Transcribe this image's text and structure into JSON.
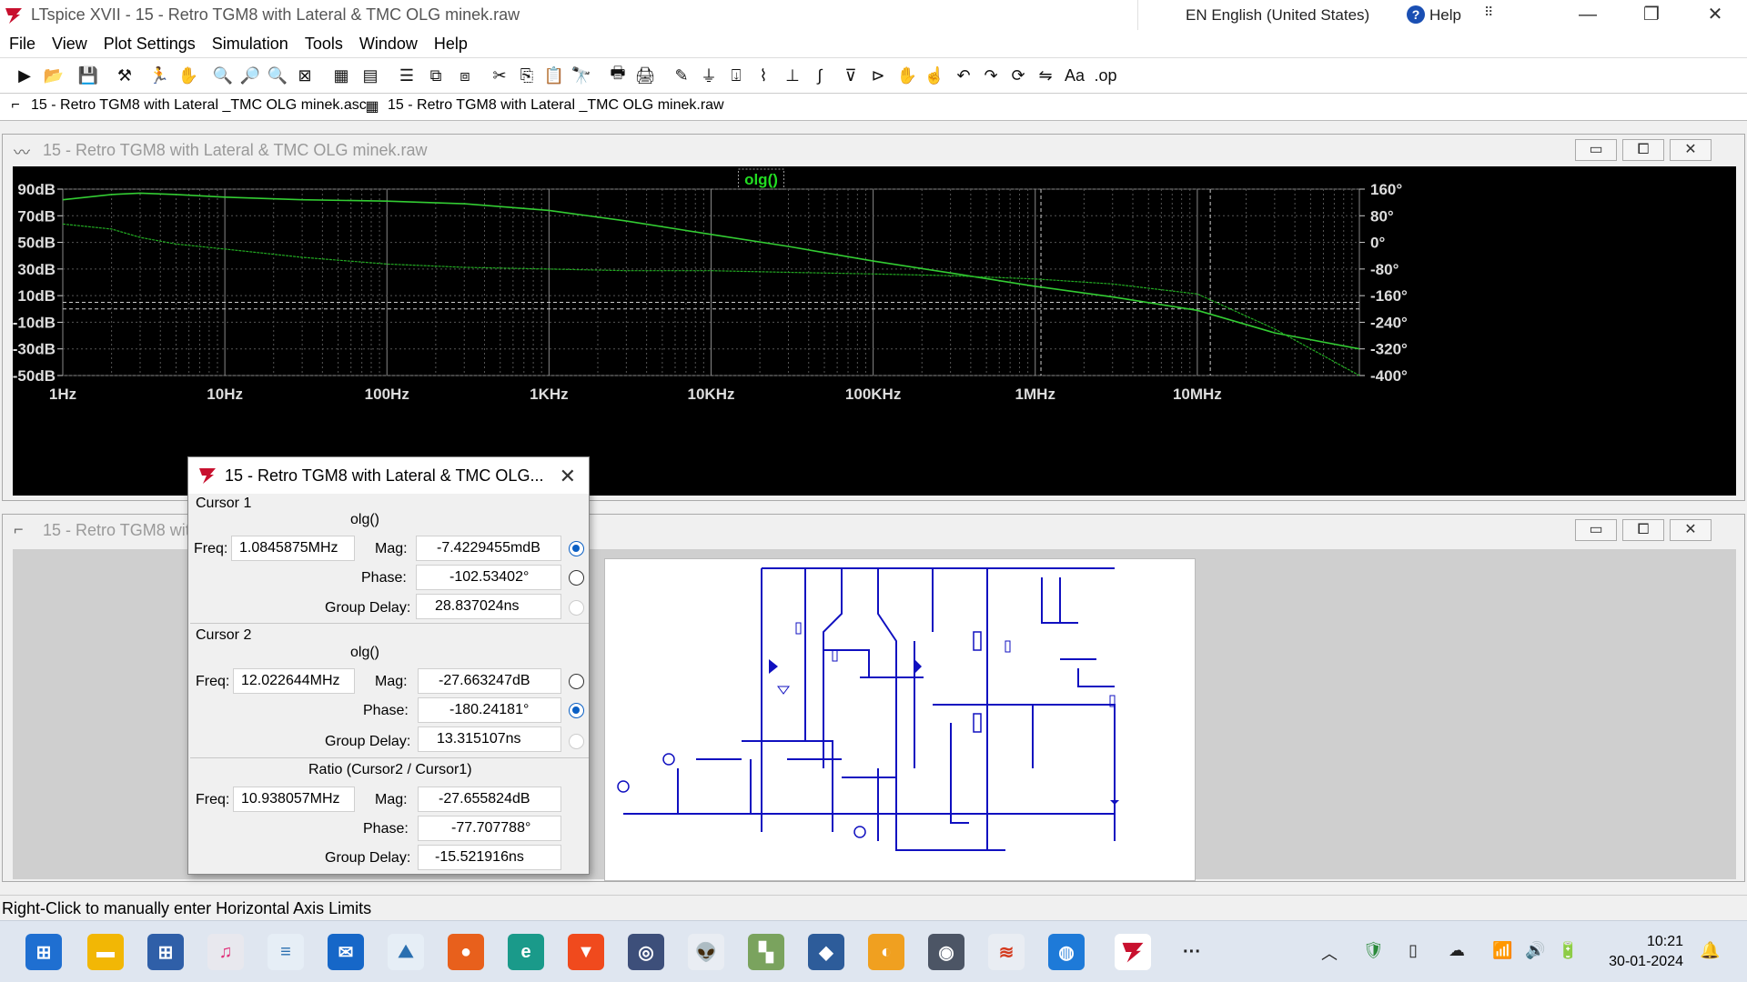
{
  "window": {
    "title": "LTspice XVII - 15 - Retro TGM8 with Lateral & TMC OLG minek.raw",
    "language": "EN English (United States)",
    "help_label": "Help"
  },
  "menu": [
    "File",
    "View",
    "Plot Settings",
    "Simulation",
    "Tools",
    "Window",
    "Help"
  ],
  "doc_tabs": [
    {
      "label": "15 - Retro TGM8 with Lateral _TMC OLG minek.asc",
      "icon": "schematic-icon"
    },
    {
      "label": "15 - Retro TGM8 with Lateral _TMC OLG minek.raw",
      "icon": "waveform-icon"
    }
  ],
  "plot_window": {
    "title": "15 - Retro TGM8 with Lateral & TMC OLG minek.raw",
    "trace_label": "olg()",
    "y_left_ticks": [
      "90dB",
      "70dB",
      "50dB",
      "30dB",
      "10dB",
      "-10dB",
      "-30dB",
      "-50dB"
    ],
    "y_right_ticks": [
      "160°",
      "80°",
      "0°",
      "-80°",
      "-160°",
      "-240°",
      "-320°",
      "-400°"
    ],
    "x_ticks": [
      "1Hz",
      "10Hz",
      "100Hz",
      "1KHz",
      "10KHz",
      "100KHz",
      "1MHz",
      "10MHz"
    ]
  },
  "schematic_window": {
    "title": "15 - Retro TGM8 with Lateral & TMC OLG minek.asc"
  },
  "chart_data": {
    "type": "line",
    "x_scale": "log",
    "xlim": [
      1,
      100000000
    ],
    "ylim_left": [
      -50,
      90
    ],
    "ylim_right": [
      -400,
      160
    ],
    "grid": true,
    "series": [
      {
        "name": "olg()",
        "axis": "magnitude_dB",
        "color": "#33cc33",
        "x": [
          1,
          2,
          3,
          5,
          10,
          30,
          100,
          300,
          1000,
          3000,
          10000,
          30000,
          100000,
          300000,
          1000000,
          3000000,
          10000000,
          30000000,
          100000000
        ],
        "y": [
          82,
          86,
          87,
          86,
          84,
          82,
          81,
          79,
          74,
          66,
          56,
          47,
          36,
          27,
          17,
          9,
          -1,
          -18,
          -30
        ]
      },
      {
        "name": "olg()",
        "axis": "phase_deg",
        "color": "#22aa22",
        "x": [
          1,
          2,
          3,
          5,
          10,
          30,
          100,
          300,
          1000,
          3000,
          10000,
          30000,
          100000,
          300000,
          1000000,
          3000000,
          10000000,
          30000000,
          100000000
        ],
        "y": [
          55,
          40,
          15,
          -5,
          -20,
          -45,
          -65,
          -75,
          -80,
          -85,
          -85,
          -90,
          -95,
          -100,
          -110,
          -125,
          -155,
          -260,
          -400
        ]
      }
    ]
  },
  "cursor_dialog": {
    "title": "15 - Retro TGM8 with Lateral & TMC OLG...",
    "cursor1": {
      "heading": "Cursor 1",
      "trace": "olg()",
      "freq_label": "Freq:",
      "freq": "1.0845875MHz",
      "mag_label": "Mag:",
      "mag": "-7.4229455mdB",
      "phase_label": "Phase:",
      "phase": "-102.53402°",
      "gd_label": "Group Delay:",
      "gd": "28.837024ns"
    },
    "cursor2": {
      "heading": "Cursor 2",
      "trace": "olg()",
      "freq_label": "Freq:",
      "freq": "12.022644MHz",
      "mag_label": "Mag:",
      "mag": "-27.663247dB",
      "phase_label": "Phase:",
      "phase": "-180.24181°",
      "gd_label": "Group Delay:",
      "gd": "13.315107ns"
    },
    "ratio": {
      "heading": "Ratio (Cursor2 / Cursor1)",
      "freq_label": "Freq:",
      "freq": "10.938057MHz",
      "mag_label": "Mag:",
      "mag": "-27.655824dB",
      "phase_label": "Phase:",
      "phase": "-77.707788°",
      "gd_label": "Group Delay:",
      "gd": "-15.521916ns"
    }
  },
  "status_text": "Right-Click to manually enter Horizontal Axis Limits",
  "clock": {
    "time": "10:21",
    "date": "30-01-2024"
  }
}
